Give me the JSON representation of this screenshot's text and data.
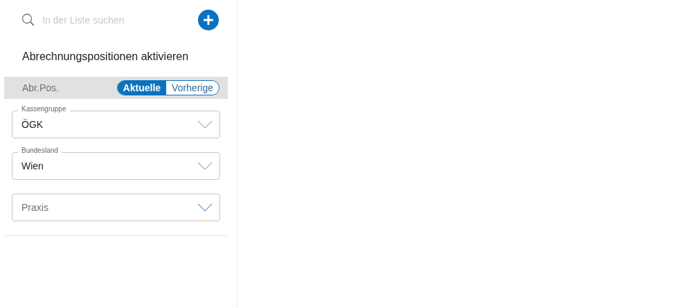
{
  "search": {
    "placeholder": "In der Liste suchen"
  },
  "title": "Abrechnungspositionen aktivieren",
  "filter_bar": {
    "label": "Abr.Pos.",
    "options": [
      {
        "label": "Aktuelle",
        "selected": true
      },
      {
        "label": "Vorherige",
        "selected": false
      }
    ]
  },
  "fields": [
    {
      "label": "Kassengruppe",
      "value": "ÖGK"
    },
    {
      "label": "Bundesland",
      "value": "Wien"
    },
    {
      "placeholder": "Praxis"
    }
  ]
}
